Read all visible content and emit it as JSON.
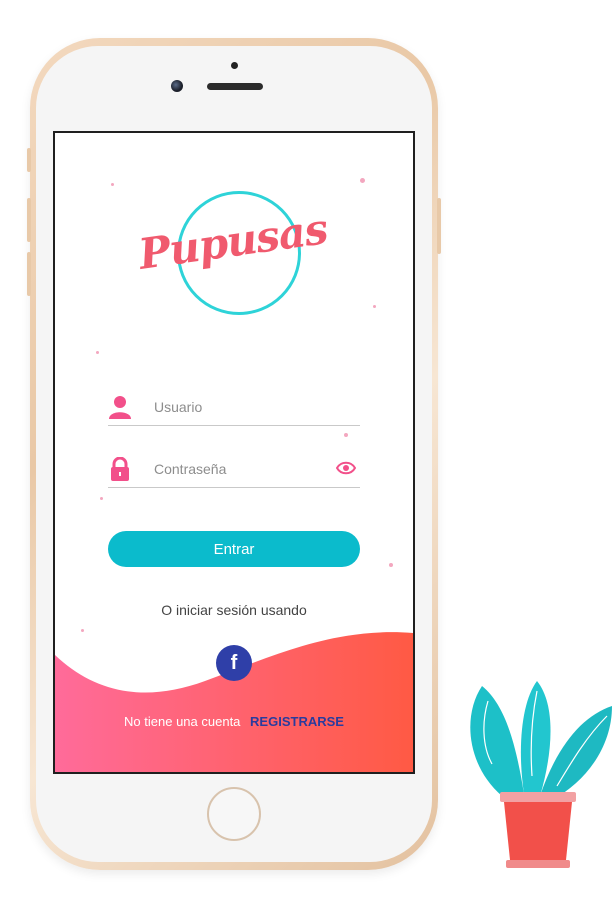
{
  "app": {
    "logo_text": "Pupusas",
    "colors": {
      "accent": "#0bbbcc",
      "brand": "#f05a6e",
      "link": "#2b3b9d",
      "gradient_start": "#ff6b9a",
      "gradient_end": "#ff5a44",
      "facebook": "#2f3fa8"
    }
  },
  "login": {
    "username_placeholder": "Usuario",
    "password_placeholder": "Contraseña",
    "username_icon": "user-icon",
    "password_icon": "lock-icon",
    "show_password_icon": "eye-icon",
    "submit_label": "Entrar",
    "alt_login_text": "O iniciar sesión usando",
    "facebook_label": "f",
    "no_account_text": "No tiene una cuenta",
    "register_label": "REGISTRARSE"
  }
}
